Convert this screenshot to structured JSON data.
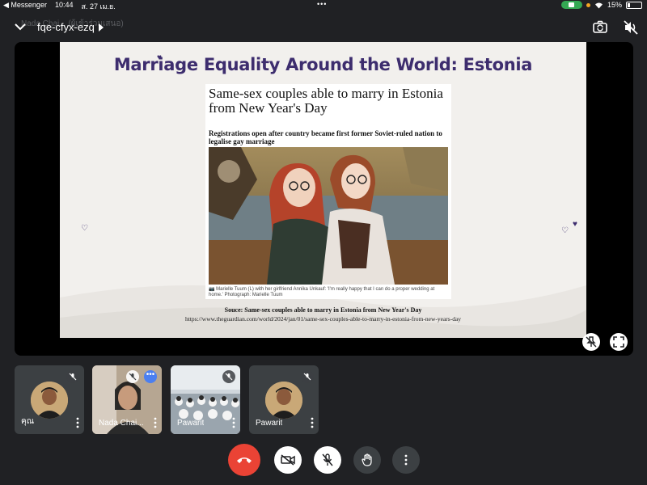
{
  "status_bar": {
    "back_app": "Messenger",
    "time": "10:44",
    "date": "ส. 27 เม.ย.",
    "battery": "15%"
  },
  "meeting": {
    "code": "fqe-cfyx-ezq",
    "ghost_header": "Nada Chai... (ผู้เข้าร่วมเสนอ)"
  },
  "slide": {
    "title": "Marriage Equality Around the World: Estonia",
    "article_title": "Same-sex couples able to marry in Estonia from New Year's Day",
    "article_subtitle": "Registrations open after country became first former Soviet-ruled nation to legalise gay marriage",
    "caption": "Marielle Tuum (L) with her girlfriend Annika Unkauf: 'I'm really happy that I can do a proper wedding at home.' Photograph: Marielle Tuum",
    "source": "Souce: Same-sex couples able to marry in Estonia from New Year's Day",
    "url": "https://www.theguardian.com/world/2024/jan/01/same-sex-couples-able-to-marry-in-estonia-from-new-years-day"
  },
  "participants": [
    {
      "name": "คุณ",
      "muted": true
    },
    {
      "name": "Nada Chai...",
      "muted": true
    },
    {
      "name": "Pawarit",
      "muted": true
    },
    {
      "name": "Pawarit",
      "muted": true
    }
  ],
  "colors": {
    "background": "#202124",
    "tile": "#3c4043",
    "end_call": "#ea4335",
    "slide_title": "#3d2d6e",
    "accent_blue": "#4b7ff0"
  },
  "icons": [
    "chevron-down-icon",
    "chevron-right-icon",
    "camera-flip-icon",
    "speaker-mute-icon",
    "pin-off-icon",
    "fullscreen-icon",
    "mic-off-icon",
    "more-vert-icon",
    "more-horiz-icon",
    "call-end-icon",
    "camera-off-icon",
    "hand-raise-icon"
  ]
}
